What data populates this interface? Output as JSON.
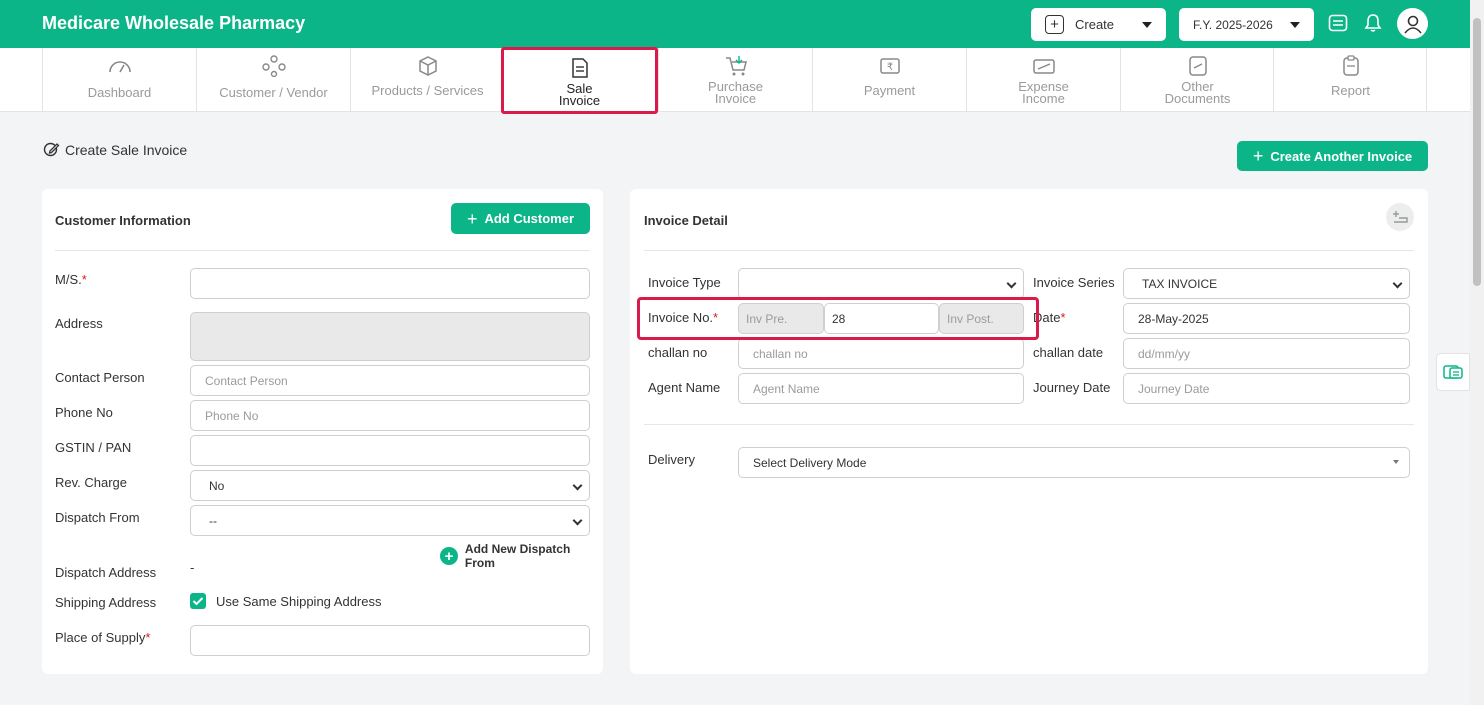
{
  "header": {
    "brand": "Medicare Wholesale Pharmacy",
    "create_label": "Create",
    "fy_label": "F.Y. 2025-2026"
  },
  "nav": {
    "items": [
      {
        "label": "Dashboard",
        "icon": "gauge-icon"
      },
      {
        "label": "Customer / Vendor",
        "icon": "users-icon"
      },
      {
        "label": "Products / Services",
        "icon": "box-icon"
      },
      {
        "label": "Sale Invoice",
        "icon": "invoice-icon"
      },
      {
        "label": "Purchase Invoice",
        "icon": "cart-icon"
      },
      {
        "label": "Payment",
        "icon": "rupee-icon"
      },
      {
        "label": "Expense Income",
        "icon": "wallet-icon"
      },
      {
        "label": "Other Documents",
        "icon": "document-icon"
      },
      {
        "label": "Report",
        "icon": "clipboard-icon"
      }
    ],
    "active": "Sale Invoice"
  },
  "page": {
    "title": "Create Sale Invoice",
    "create_another_label": "Create Another Invoice"
  },
  "customer": {
    "title": "Customer Information",
    "add_label": "Add Customer",
    "ms_label": "M/S.",
    "address_label": "Address",
    "contact_label": "Contact Person",
    "contact_placeholder": "Contact Person",
    "phone_label": "Phone No",
    "phone_placeholder": "Phone No",
    "gstin_label": "GSTIN / PAN",
    "rev_label": "Rev. Charge",
    "rev_value": "No",
    "dispatch_label": "Dispatch From",
    "dispatch_value": "--",
    "add_dispatch_label": "Add New Dispatch From",
    "dispatch_address_label": "Dispatch Address",
    "dispatch_address_value": "-",
    "shipping_label": "Shipping Address",
    "same_shipping_label": "Use Same Shipping Address",
    "place_label": "Place of Supply"
  },
  "invoice": {
    "title": "Invoice Detail",
    "type_label": "Invoice Type",
    "type_value": "",
    "series_label": "Invoice Series",
    "series_value": "TAX INVOICE",
    "no_label": "Invoice No.",
    "pre_placeholder": "Inv Pre.",
    "no_value": "28",
    "post_placeholder": "Inv Post.",
    "date_label": "Date",
    "date_value": "28-May-2025",
    "challan_label": "challan no",
    "challan_placeholder": "challan no",
    "challan_date_label": "challan date",
    "challan_date_placeholder": "dd/mm/yy",
    "agent_label": "Agent Name",
    "agent_placeholder": "Agent Name",
    "journey_label": "Journey Date",
    "journey_placeholder": "Journey Date",
    "delivery_label": "Delivery",
    "delivery_value": "Select Delivery Mode"
  },
  "colors": {
    "brand": "#0bb587",
    "highlight": "#d81b4a",
    "required": "#d81b1b"
  }
}
